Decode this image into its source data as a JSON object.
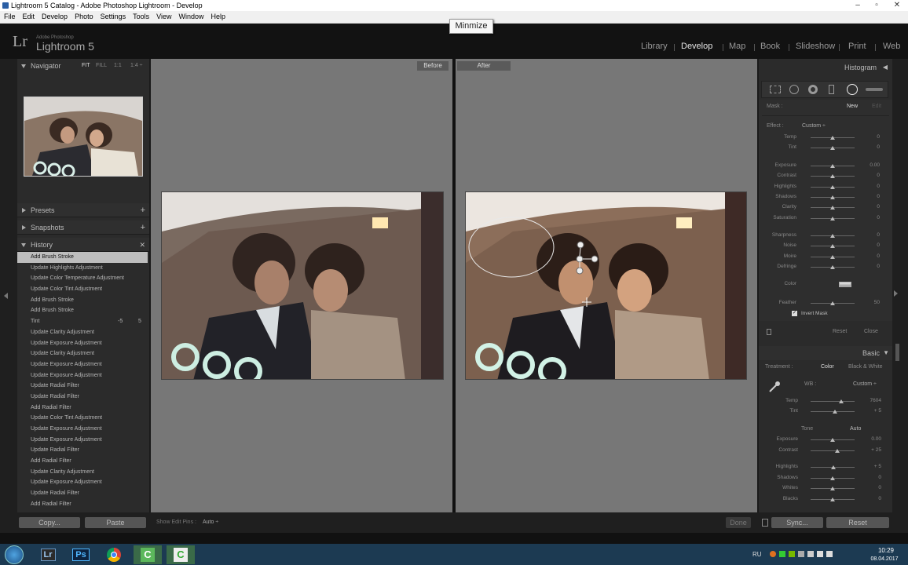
{
  "window": {
    "title": "Lightroom 5 Catalog - Adobe Photoshop Lightroom - Develop"
  },
  "menu": [
    "File",
    "Edit",
    "Develop",
    "Photo",
    "Settings",
    "Tools",
    "View",
    "Window",
    "Help"
  ],
  "header": {
    "logo": "Lr",
    "adobe": "Adobe Photoshop",
    "app": "Lightroom 5",
    "modules": [
      "Library",
      "Develop",
      "Map",
      "Book",
      "Slideshow",
      "Print",
      "Web"
    ],
    "active_module": "Develop"
  },
  "tooltip": "Minmize",
  "left": {
    "navigator": {
      "title": "Navigator",
      "zoom": [
        "FIT",
        "FILL",
        "1:1",
        "1:4 ÷"
      ]
    },
    "presets": "Presets",
    "snapshots": "Snapshots",
    "history": "History",
    "history_items": [
      "Add Brush Stroke",
      "Update Highlights Adjustment",
      "Update Color Temperature Adjustment",
      "Update Color Tint Adjustment",
      "Add Brush Stroke",
      "Add Brush Stroke",
      "Tint",
      "Update Clarity Adjustment",
      "Update Exposure Adjustment",
      "Update Clarity Adjustment",
      "Update Exposure Adjustment",
      "Update Exposure Adjustment",
      "Update Radial Filter",
      "Update Radial Filter",
      "Add Radial Filter",
      "Update Color Tint Adjustment",
      "Update Exposure Adjustment",
      "Update Exposure Adjustment",
      "Update Radial Filter",
      "Add Radial Filter",
      "Update Clarity Adjustment",
      "Update Exposure Adjustment",
      "Update Radial Filter",
      "Add Radial Filter"
    ],
    "tint_values": [
      "-5",
      "5"
    ]
  },
  "view": {
    "before": "Before",
    "after": "After"
  },
  "right": {
    "histogram": "Histogram",
    "mask": {
      "label": "Mask :",
      "new": "New",
      "edit": "Edit"
    },
    "effect": {
      "label": "Effect :",
      "value": "Custom ÷"
    },
    "sliders1": [
      {
        "name": "Temp",
        "value": "0",
        "pos": 0.5
      },
      {
        "name": "Tint",
        "value": "0",
        "pos": 0.5
      }
    ],
    "sliders2": [
      {
        "name": "Exposure",
        "value": "0.00",
        "pos": 0.5
      },
      {
        "name": "Contrast",
        "value": "0",
        "pos": 0.5
      },
      {
        "name": "Highlights",
        "value": "0",
        "pos": 0.5
      },
      {
        "name": "Shadows",
        "value": "0",
        "pos": 0.5
      },
      {
        "name": "Clarity",
        "value": "0",
        "pos": 0.5
      },
      {
        "name": "Saturation",
        "value": "0",
        "pos": 0.5
      }
    ],
    "sliders3": [
      {
        "name": "Sharpness",
        "value": "0",
        "pos": 0.5
      },
      {
        "name": "Noise",
        "value": "0",
        "pos": 0.5
      },
      {
        "name": "Moire",
        "value": "0",
        "pos": 0.5
      },
      {
        "name": "Defringe",
        "value": "0",
        "pos": 0.5
      }
    ],
    "color_label": "Color",
    "feather": {
      "name": "Feather",
      "value": "50",
      "pos": 0.5
    },
    "invert_mask": "Invert Mask",
    "reset": "Reset",
    "close": "Close",
    "basic": "Basic",
    "treatment": {
      "label": "Treatment :",
      "color": "Color",
      "bw": "Black & White"
    },
    "wb": {
      "label": "WB :",
      "value": "Custom ÷"
    },
    "wb_sliders": [
      {
        "name": "Temp",
        "value": "7604",
        "pos": 0.7
      },
      {
        "name": "Tint",
        "value": "+ 5",
        "pos": 0.55
      }
    ],
    "tone": {
      "label": "Tone",
      "auto": "Auto"
    },
    "tone_sliders": [
      {
        "name": "Exposure",
        "value": "0.00",
        "pos": 0.5
      },
      {
        "name": "Contrast",
        "value": "+ 25",
        "pos": 0.6
      },
      {
        "name": "Highlights",
        "value": "+ 5",
        "pos": 0.52
      },
      {
        "name": "Shadows",
        "value": "0",
        "pos": 0.5
      },
      {
        "name": "Whites",
        "value": "0",
        "pos": 0.5
      },
      {
        "name": "Blacks",
        "value": "0",
        "pos": 0.5
      }
    ]
  },
  "bottom": {
    "copy": "Copy...",
    "paste": "Paste",
    "show_pins_label": "Show Edit Pins :",
    "show_pins_value": "Auto ÷",
    "done": "Done",
    "sync": "Sync...",
    "reset": "Reset"
  },
  "taskbar": {
    "lang": "RU",
    "time": "10:29",
    "date": "08.04.2017",
    "apps": [
      "Lr",
      "Ps",
      "chrome-icon",
      "camtasia-icon",
      "camtasia-recorder-icon"
    ]
  }
}
